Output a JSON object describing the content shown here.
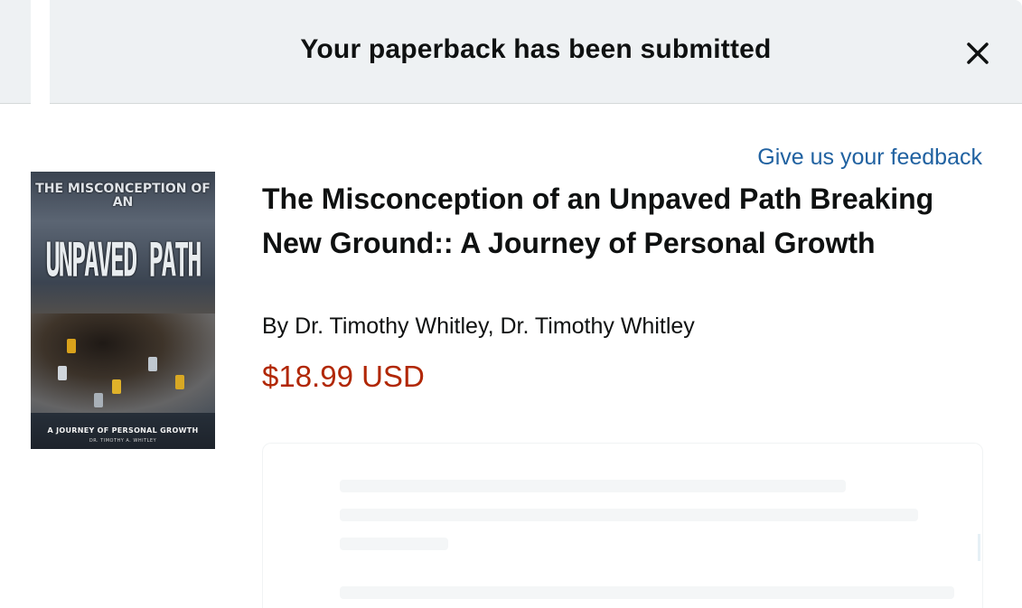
{
  "banner": {
    "title": "Your paperback has been submitted",
    "close_icon": "close-icon"
  },
  "feedback_link": "Give us your feedback",
  "book": {
    "title": "The Misconception of an Unpaved Path Breaking New Ground:: A Journey of Personal Growth",
    "byline": "By Dr. Timothy Whitley, Dr. Timothy Whitley",
    "price": "$18.99 USD",
    "cover": {
      "top_text": "THE MISCONCEPTION OF AN",
      "big_text": "UNPAVED PATH",
      "subtitle": "A JOURNEY OF PERSONAL GROWTH",
      "author": "DR. TIMOTHY A. WHITLEY"
    }
  },
  "colors": {
    "banner_bg": "#eef1f3",
    "link": "#2162a1",
    "price": "#b12704"
  }
}
